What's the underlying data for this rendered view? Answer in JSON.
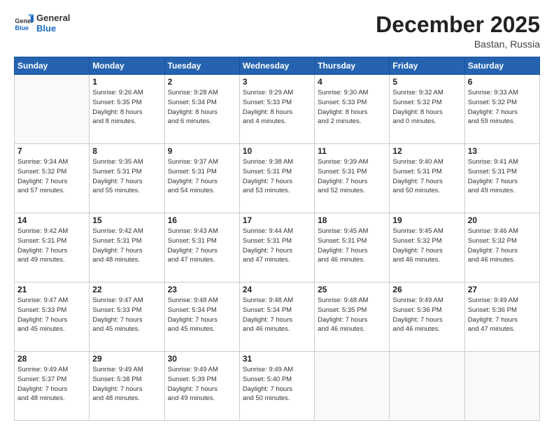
{
  "logo": {
    "line1": "General",
    "line2": "Blue"
  },
  "title": "December 2025",
  "location": "Bastan, Russia",
  "weekdays": [
    "Sunday",
    "Monday",
    "Tuesday",
    "Wednesday",
    "Thursday",
    "Friday",
    "Saturday"
  ],
  "weeks": [
    [
      {
        "day": "",
        "info": ""
      },
      {
        "day": "1",
        "info": "Sunrise: 9:26 AM\nSunset: 5:35 PM\nDaylight: 8 hours\nand 8 minutes."
      },
      {
        "day": "2",
        "info": "Sunrise: 9:28 AM\nSunset: 5:34 PM\nDaylight: 8 hours\nand 6 minutes."
      },
      {
        "day": "3",
        "info": "Sunrise: 9:29 AM\nSunset: 5:33 PM\nDaylight: 8 hours\nand 4 minutes."
      },
      {
        "day": "4",
        "info": "Sunrise: 9:30 AM\nSunset: 5:33 PM\nDaylight: 8 hours\nand 2 minutes."
      },
      {
        "day": "5",
        "info": "Sunrise: 9:32 AM\nSunset: 5:32 PM\nDaylight: 8 hours\nand 0 minutes."
      },
      {
        "day": "6",
        "info": "Sunrise: 9:33 AM\nSunset: 5:32 PM\nDaylight: 7 hours\nand 59 minutes."
      }
    ],
    [
      {
        "day": "7",
        "info": "Sunrise: 9:34 AM\nSunset: 5:32 PM\nDaylight: 7 hours\nand 57 minutes."
      },
      {
        "day": "8",
        "info": "Sunrise: 9:35 AM\nSunset: 5:31 PM\nDaylight: 7 hours\nand 55 minutes."
      },
      {
        "day": "9",
        "info": "Sunrise: 9:37 AM\nSunset: 5:31 PM\nDaylight: 7 hours\nand 54 minutes."
      },
      {
        "day": "10",
        "info": "Sunrise: 9:38 AM\nSunset: 5:31 PM\nDaylight: 7 hours\nand 53 minutes."
      },
      {
        "day": "11",
        "info": "Sunrise: 9:39 AM\nSunset: 5:31 PM\nDaylight: 7 hours\nand 52 minutes."
      },
      {
        "day": "12",
        "info": "Sunrise: 9:40 AM\nSunset: 5:31 PM\nDaylight: 7 hours\nand 50 minutes."
      },
      {
        "day": "13",
        "info": "Sunrise: 9:41 AM\nSunset: 5:31 PM\nDaylight: 7 hours\nand 49 minutes."
      }
    ],
    [
      {
        "day": "14",
        "info": "Sunrise: 9:42 AM\nSunset: 5:31 PM\nDaylight: 7 hours\nand 49 minutes."
      },
      {
        "day": "15",
        "info": "Sunrise: 9:42 AM\nSunset: 5:31 PM\nDaylight: 7 hours\nand 48 minutes."
      },
      {
        "day": "16",
        "info": "Sunrise: 9:43 AM\nSunset: 5:31 PM\nDaylight: 7 hours\nand 47 minutes."
      },
      {
        "day": "17",
        "info": "Sunrise: 9:44 AM\nSunset: 5:31 PM\nDaylight: 7 hours\nand 47 minutes."
      },
      {
        "day": "18",
        "info": "Sunrise: 9:45 AM\nSunset: 5:31 PM\nDaylight: 7 hours\nand 46 minutes."
      },
      {
        "day": "19",
        "info": "Sunrise: 9:45 AM\nSunset: 5:32 PM\nDaylight: 7 hours\nand 46 minutes."
      },
      {
        "day": "20",
        "info": "Sunrise: 9:46 AM\nSunset: 5:32 PM\nDaylight: 7 hours\nand 46 minutes."
      }
    ],
    [
      {
        "day": "21",
        "info": "Sunrise: 9:47 AM\nSunset: 5:33 PM\nDaylight: 7 hours\nand 45 minutes."
      },
      {
        "day": "22",
        "info": "Sunrise: 9:47 AM\nSunset: 5:33 PM\nDaylight: 7 hours\nand 45 minutes."
      },
      {
        "day": "23",
        "info": "Sunrise: 9:48 AM\nSunset: 5:34 PM\nDaylight: 7 hours\nand 45 minutes."
      },
      {
        "day": "24",
        "info": "Sunrise: 9:48 AM\nSunset: 5:34 PM\nDaylight: 7 hours\nand 46 minutes."
      },
      {
        "day": "25",
        "info": "Sunrise: 9:48 AM\nSunset: 5:35 PM\nDaylight: 7 hours\nand 46 minutes."
      },
      {
        "day": "26",
        "info": "Sunrise: 9:49 AM\nSunset: 5:36 PM\nDaylight: 7 hours\nand 46 minutes."
      },
      {
        "day": "27",
        "info": "Sunrise: 9:49 AM\nSunset: 5:36 PM\nDaylight: 7 hours\nand 47 minutes."
      }
    ],
    [
      {
        "day": "28",
        "info": "Sunrise: 9:49 AM\nSunset: 5:37 PM\nDaylight: 7 hours\nand 48 minutes."
      },
      {
        "day": "29",
        "info": "Sunrise: 9:49 AM\nSunset: 5:38 PM\nDaylight: 7 hours\nand 48 minutes."
      },
      {
        "day": "30",
        "info": "Sunrise: 9:49 AM\nSunset: 5:39 PM\nDaylight: 7 hours\nand 49 minutes."
      },
      {
        "day": "31",
        "info": "Sunrise: 9:49 AM\nSunset: 5:40 PM\nDaylight: 7 hours\nand 50 minutes."
      },
      {
        "day": "",
        "info": ""
      },
      {
        "day": "",
        "info": ""
      },
      {
        "day": "",
        "info": ""
      }
    ]
  ]
}
